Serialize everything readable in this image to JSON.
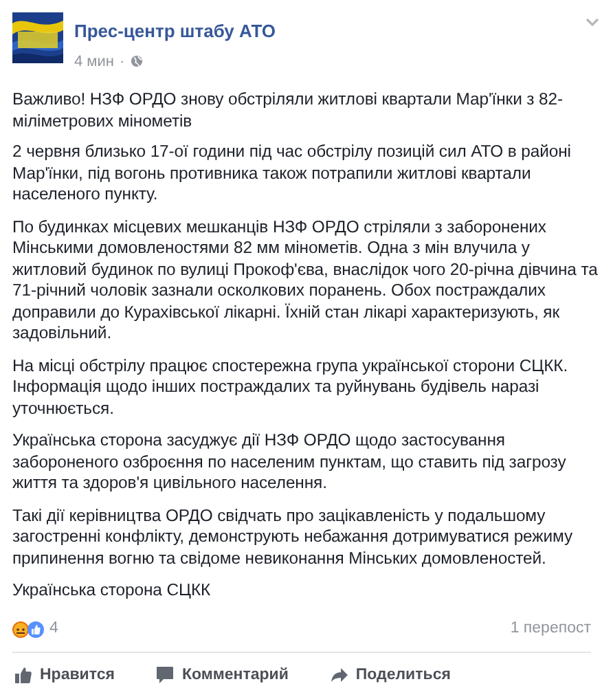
{
  "post": {
    "author": "Прес-центр штабу АТО",
    "time": "4 мин",
    "separator": "·",
    "paragraphs": [
      "Важливо! НЗФ ОРДО знову обстріляли житлові квартали Мар'їнки з 82-міліметрових мінометів",
      "2 червня близько 17-ої години під час обстрілу позицій сил АТО в районі Мар'їнки, під вогонь противника також потрапили житлові квартали населеного пункту.",
      "По будинках місцевих мешканців НЗФ ОРДО стріляли з заборонених Мінськими домовленостями 82 мм мінометів. Одна з мін влучила у житловий будинок по вулиці Прокоф'єва, внаслідок чого 20-річна дівчина та 71-річний чоловік зазнали осколкових поранень. Обох постраждалих доправили до Курахівської лікарні. Їхній стан лікарі характеризують, як задовільний.",
      "На місці обстрілу працює спостережна група української сторони СЦКК. Інформація щодо інших постраждалих та руйнувань будівель наразі уточнюється.",
      "Українська сторона засуджує дії НЗФ ОРДО щодо застосування забороненого озброєння по населеним пунктам, що ставить під загрозу життя та здоров'я цивільного населення.",
      "Такі дії керівництва ОРДО свідчать про зацікавленість у подальшому загостренні конфлікту, демонструють небажання дотримуватися режиму припинення вогню та свідоме невиконання Мінських домовленостей.",
      "Українська сторона СЦКК"
    ],
    "reaction_count": "4",
    "shares": "1 перепост",
    "actions": [
      {
        "kind": "like",
        "label": "Нравится"
      },
      {
        "kind": "comment",
        "label": "Комментарий"
      },
      {
        "kind": "share",
        "label": "Поделиться"
      }
    ]
  }
}
